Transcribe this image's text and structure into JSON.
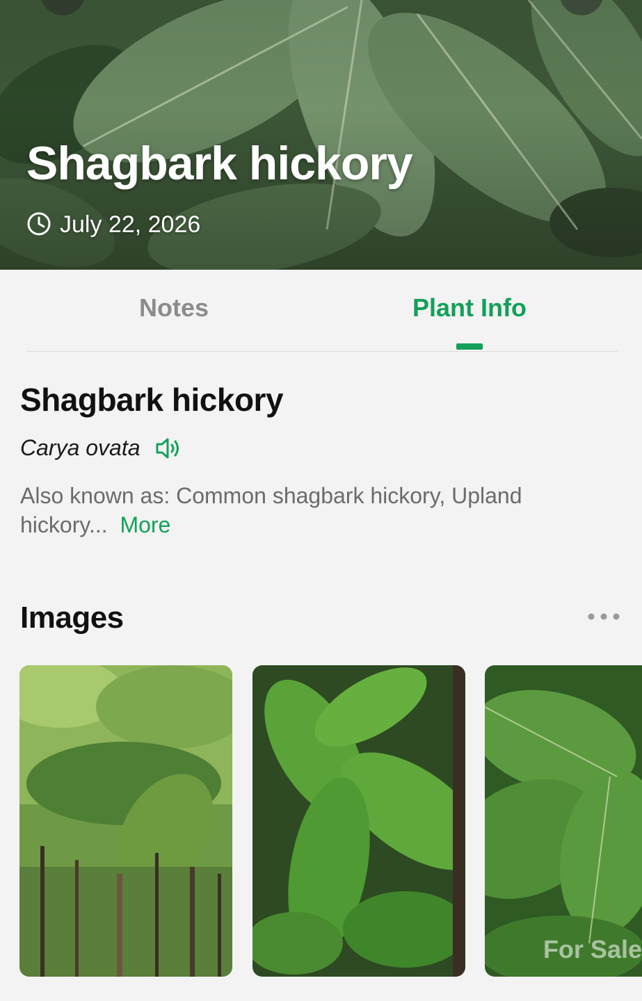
{
  "hero": {
    "title": "Shagbark hickory",
    "date": "July 22, 2026",
    "date_icon": "clock-icon"
  },
  "tabs": [
    {
      "label": "Notes",
      "active": false
    },
    {
      "label": "Plant Info",
      "active": true
    }
  ],
  "plant": {
    "common_name": "Shagbark hickory",
    "scientific_name": "Carya ovata",
    "pronounce_icon": "speaker-icon",
    "also_known_as": "Also known as: Common shagbark hickory, Upland hickory...",
    "more_label": "More"
  },
  "images_section": {
    "title": "Images",
    "menu_icon": "more-dots-icon"
  },
  "watermark": "For Sale",
  "colors": {
    "accent": "#14a05a",
    "inactive_tab": "#8c8c8c",
    "background": "#f3f3f3",
    "title_text": "#111111",
    "secondary_text": "#6b6b6b"
  }
}
